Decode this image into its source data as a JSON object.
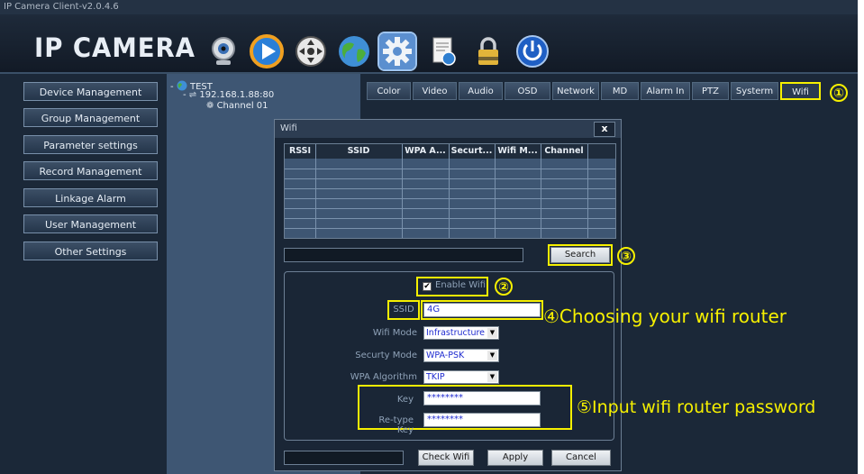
{
  "window": {
    "title": "IP Camera Client-v2.0.4.6"
  },
  "header": {
    "logo": "IP CAMERA",
    "toolbar": [
      {
        "icon": "webcam-icon"
      },
      {
        "icon": "play-icon"
      },
      {
        "icon": "ptz-control-icon"
      },
      {
        "icon": "globe-icon"
      },
      {
        "icon": "settings-gear-icon",
        "selected": true
      },
      {
        "icon": "record-doc-icon"
      },
      {
        "icon": "lock-icon"
      },
      {
        "icon": "power-icon"
      }
    ]
  },
  "sidebar": {
    "items": [
      {
        "label": "Device Management"
      },
      {
        "label": "Group Management"
      },
      {
        "label": "Parameter settings"
      },
      {
        "label": "Record Management"
      },
      {
        "label": "Linkage Alarm"
      },
      {
        "label": "User Management"
      },
      {
        "label": "Other Settings"
      }
    ]
  },
  "tree": {
    "root": "TEST",
    "device": "192.168.1.88:80",
    "channel": "Channel 01"
  },
  "tabs": [
    {
      "label": "Color"
    },
    {
      "label": "Video"
    },
    {
      "label": "Audio"
    },
    {
      "label": "OSD"
    },
    {
      "label": "Network"
    },
    {
      "label": "MD"
    },
    {
      "label": "Alarm In"
    },
    {
      "label": "PTZ"
    },
    {
      "label": "Systerm"
    },
    {
      "label": "Wifi",
      "active": true
    }
  ],
  "dialog": {
    "title": "Wifi",
    "close": "x",
    "columns": [
      "RSSI",
      "SSID",
      "WPA A...",
      "Securt...",
      "Wifi M...",
      "Channel"
    ],
    "search_button": "Search",
    "enable_wifi_label": "Enable Wifi",
    "enable_wifi_checked": true,
    "ssid_label": "SSID",
    "ssid_value": "4G",
    "wifi_mode_label": "Wifi Mode",
    "wifi_mode_value": "Infrastructure",
    "security_mode_label": "Securty Mode",
    "security_mode_value": "WPA-PSK",
    "wpa_algorithm_label": "WPA Algorithm",
    "wpa_algorithm_value": "TKIP",
    "key_label": "Key",
    "key_value": "********",
    "retype_key_label": "Re-type Key",
    "retype_key_value": "********",
    "check_wifi_button": "Check Wifi",
    "apply_button": "Apply",
    "cancel_button": "Cancel"
  },
  "annotations": {
    "n1": "①",
    "n2": "②",
    "n3": "③",
    "n4": "④Choosing your wifi router",
    "n5": "⑤Input wifi router password"
  },
  "colors": {
    "highlight": "#f6f000",
    "app_bg": "#1b2838",
    "tree_bg": "#3e5673"
  }
}
